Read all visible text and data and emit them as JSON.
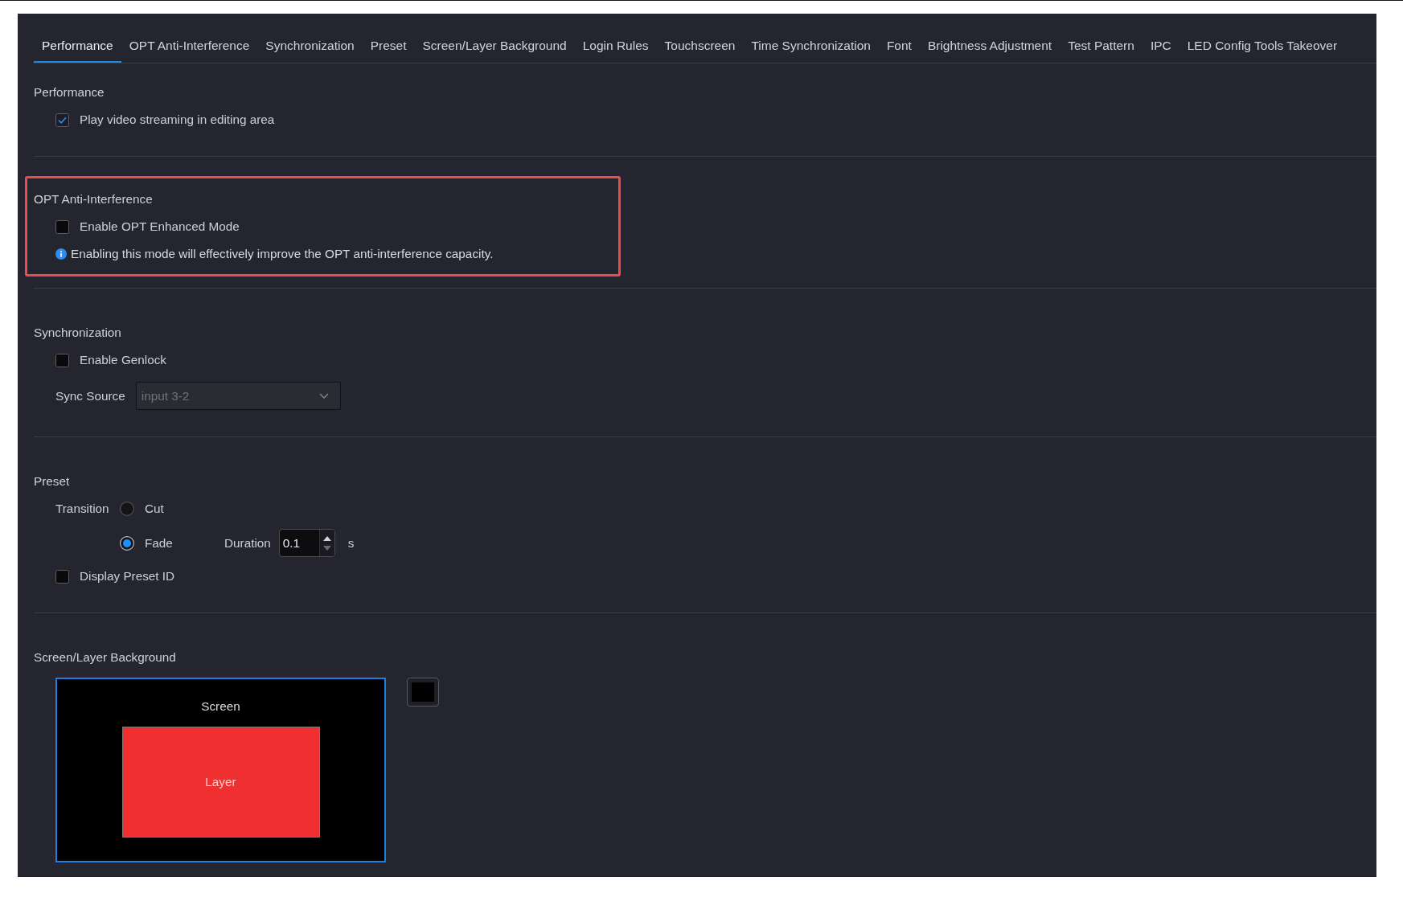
{
  "tabs": [
    {
      "label": "Performance",
      "selected": true
    },
    {
      "label": "OPT Anti-Interference",
      "selected": false
    },
    {
      "label": "Synchronization",
      "selected": false
    },
    {
      "label": "Preset",
      "selected": false
    },
    {
      "label": "Screen/Layer Background",
      "selected": false
    },
    {
      "label": "Login Rules",
      "selected": false
    },
    {
      "label": "Touchscreen",
      "selected": false
    },
    {
      "label": "Time Synchronization",
      "selected": false
    },
    {
      "label": "Font",
      "selected": false
    },
    {
      "label": "Brightness Adjustment",
      "selected": false
    },
    {
      "label": "Test Pattern",
      "selected": false
    },
    {
      "label": "IPC",
      "selected": false
    },
    {
      "label": "LED Config Tools Takeover",
      "selected": false
    }
  ],
  "sections": [
    {
      "title": "Performance",
      "highlighted": false,
      "controls": [
        {
          "kind": "checkbox",
          "label": "Play video streaming in editing area",
          "checked": true
        }
      ]
    },
    {
      "title": "OPT Anti-Interference",
      "highlighted": true,
      "controls": [
        {
          "kind": "checkbox",
          "label": "Enable OPT Enhanced Mode",
          "checked": false
        },
        {
          "kind": "info",
          "text": "Enabling this mode will effectively improve the OPT anti-interference capacity."
        }
      ]
    },
    {
      "title": "Synchronization",
      "highlighted": false,
      "controls": [
        {
          "kind": "checkbox",
          "label": "Enable Genlock",
          "checked": false
        },
        {
          "kind": "select",
          "label": "Sync Source",
          "value": "input 3-2",
          "disabled": true
        }
      ]
    },
    {
      "title": "Preset",
      "highlighted": false,
      "controls": [
        {
          "kind": "radio_group",
          "label": "Transition",
          "options": [
            {
              "label": "Cut",
              "selected": false
            },
            {
              "label": "Fade",
              "selected": true,
              "duration": {
                "label": "Duration",
                "value": "0.1",
                "unit": "s"
              }
            }
          ]
        },
        {
          "kind": "checkbox",
          "label": "Display Preset ID",
          "checked": false
        }
      ]
    },
    {
      "title": "Screen/Layer Background",
      "highlighted": false,
      "controls": [
        {
          "kind": "preview",
          "screen_label": "Screen",
          "layer_label": "Layer"
        }
      ]
    }
  ]
}
